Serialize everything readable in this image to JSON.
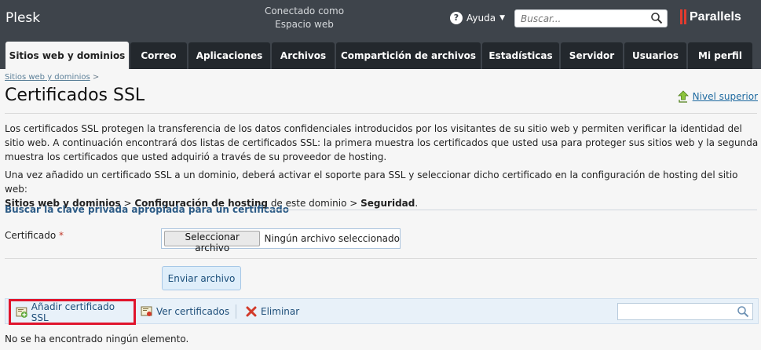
{
  "header": {
    "brand": "Plesk",
    "connected_line1": "Conectado como",
    "connected_line2": "Espacio web",
    "help_label": "Ayuda",
    "search_placeholder": "Buscar...",
    "logo_text": "Parallels",
    "logo_color": "#e23b2f"
  },
  "tabs": [
    {
      "label": "Sitios web y dominios",
      "active": true
    },
    {
      "label": "Correo"
    },
    {
      "label": "Aplicaciones"
    },
    {
      "label": "Archivos"
    },
    {
      "label": "Compartición de archivos"
    },
    {
      "label": "Estadísticas"
    },
    {
      "label": "Servidor"
    },
    {
      "label": "Usuarios"
    },
    {
      "label": "Mi perfil"
    }
  ],
  "breadcrumb": {
    "link": "Sitios web y dominios",
    "separator": ">"
  },
  "page": {
    "title": "Certificados SSL",
    "up_level": "Nivel superior",
    "paragraph1": "Los certificados SSL protegen la transferencia de los datos confidenciales introducidos por los visitantes de su sitio web y permiten verificar la identidad del sitio web. A continuación encontrará dos listas de certificados SSL: la primera muestra los certificados que usted usa para proteger sus sitios web y la segunda muestra los certificados que usted adquirió a través de su proveedor de hosting.",
    "paragraph2_prefix": "Una vez añadido un certificado SSL a un dominio, deberá activar el soporte para SSL y seleccionar dicho certificado en la configuración de hosting del sitio web:",
    "paragraph2_path1": "Sitios web y dominios",
    "paragraph2_sep1": " > ",
    "paragraph2_path2": "Configuración de hosting",
    "paragraph2_mid": " de este dominio > ",
    "paragraph2_path3": "Seguridad",
    "paragraph2_end": "."
  },
  "form": {
    "legend": "Buscar la clave privada apropiada para un certificado",
    "certificate_label": "Certificado",
    "required_mark": "*",
    "choose_file_button": "Seleccionar archivo",
    "no_file_text": "Ningún archivo seleccionado",
    "submit_button": "Enviar archivo"
  },
  "toolbar": {
    "add_label": "Añadir certificado SSL",
    "view_label": "Ver certificados",
    "delete_label": "Eliminar",
    "search_value": ""
  },
  "list": {
    "empty_message": "No se ha encontrado ningún elemento."
  }
}
